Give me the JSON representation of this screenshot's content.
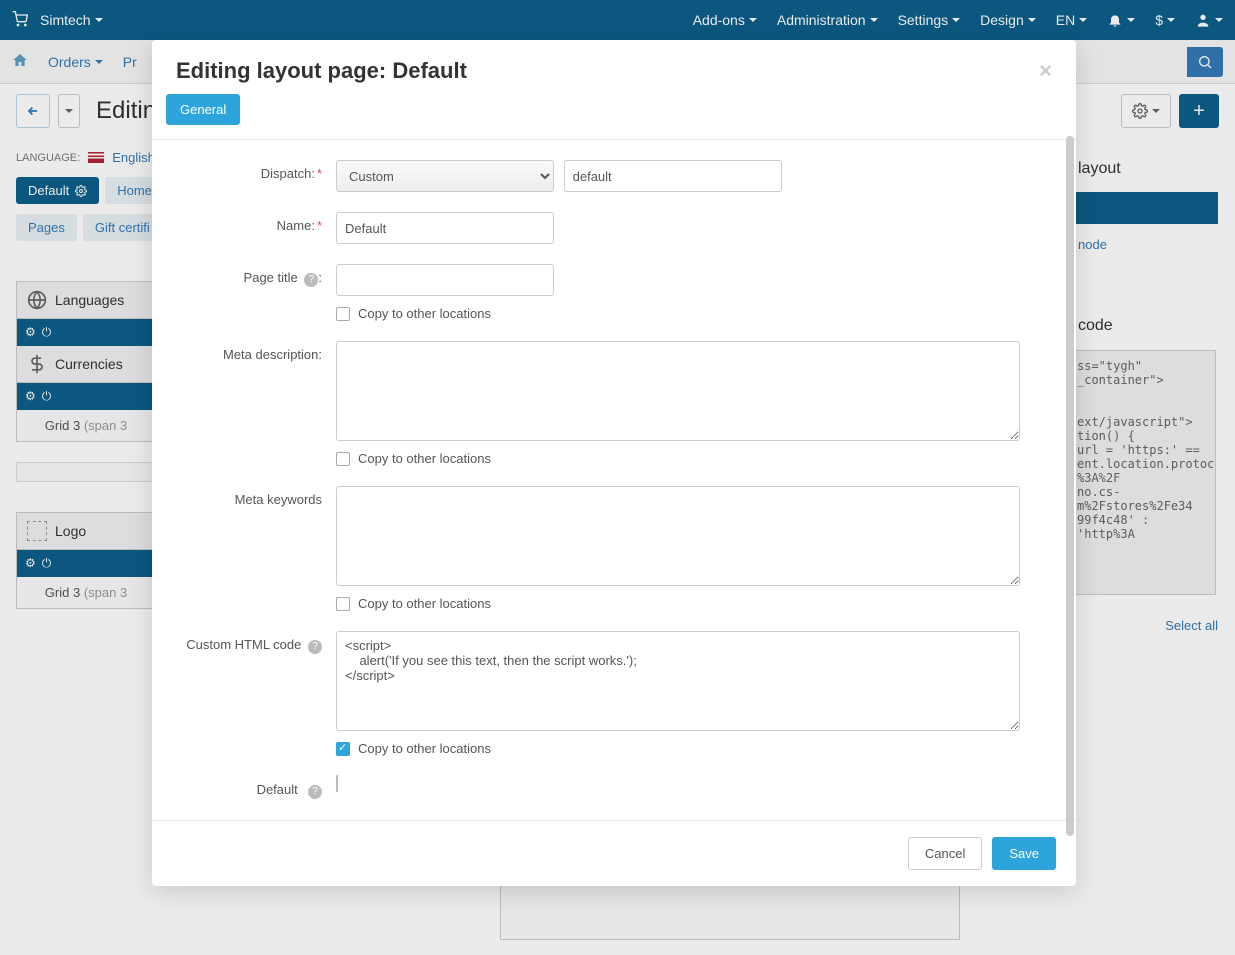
{
  "navbar": {
    "brand": "Simtech",
    "menu": {
      "addons": "Add-ons",
      "administration": "Administration",
      "settings": "Settings",
      "design": "Design",
      "lang": "EN",
      "currency": "$"
    }
  },
  "subnav": {
    "orders": "Orders",
    "products_prefix": "Pr"
  },
  "page_header": {
    "title": "Editing"
  },
  "language_bar": {
    "label": "LANGUAGE:",
    "value": "English"
  },
  "bg_tabs": {
    "default": "Default",
    "homepage": "Homep",
    "pages": "Pages",
    "gift": "Gift certifi"
  },
  "grid_blocks": {
    "languages": "Languages",
    "currencies": "Currencies",
    "logo": "Logo",
    "grid3": "Grid 3",
    "span3": "(span 3"
  },
  "right_panel": {
    "layout": "layout",
    "node": "node",
    "code": "code",
    "code_content": "ss=\"tygh\"\n_container\">\n\n\next/javascript\">\ntion() {\nurl = 'https:' ==\nent.location.protocol\n%3A%2F\nno.cs-\nm%2Fstores%2Fe34\n99f4c48' : 'http%3A",
    "question": "?",
    "select_all": "Select all"
  },
  "modal": {
    "title": "Editing layout page: Default",
    "tab_general": "General",
    "labels": {
      "dispatch": "Dispatch:",
      "name": "Name:",
      "page_title": "Page title",
      "meta_description": "Meta description:",
      "meta_keywords": "Meta keywords",
      "custom_html": "Custom HTML code",
      "default": "Default",
      "copy_to_other": "Copy to other locations"
    },
    "values": {
      "dispatch_select": "Custom",
      "dispatch_text": "default",
      "name": "Default",
      "page_title": "",
      "meta_description": "",
      "meta_keywords": "",
      "custom_html": "<script>\n    alert('If you see this text, then the script works.');\n</script>"
    },
    "footer": {
      "cancel": "Cancel",
      "save": "Save"
    }
  }
}
